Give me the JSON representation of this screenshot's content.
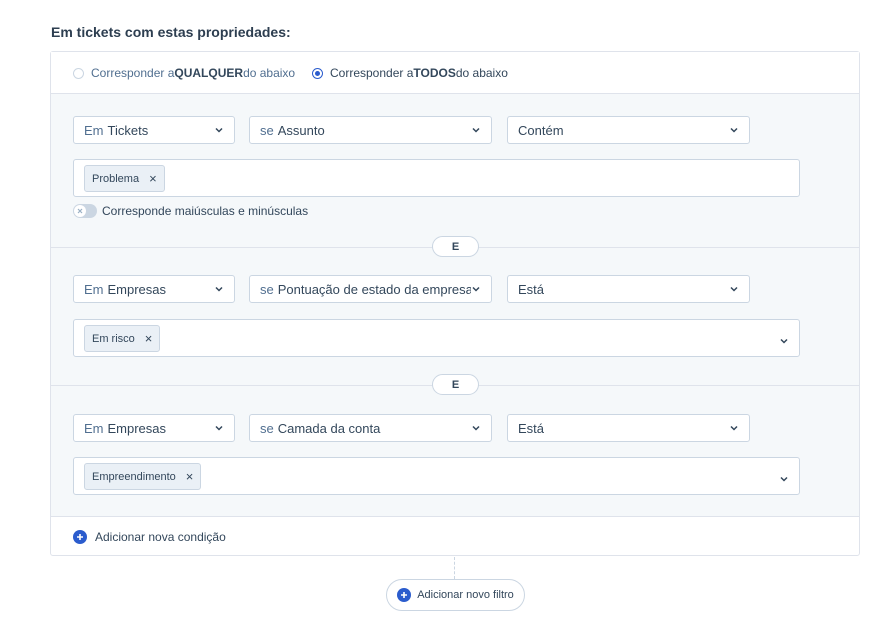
{
  "heading": "Em tickets com estas propriedades:",
  "match": {
    "any_prefix": "Corresponder a ",
    "any_strong": "QUALQUER",
    "any_suffix": " do abaixo",
    "all_prefix": "Corresponder a ",
    "all_strong": "TODOS",
    "all_suffix": " do abaixo",
    "selected": "all"
  },
  "conditions": [
    {
      "object_prefix": "Em",
      "object": "Tickets",
      "property_prefix": "se",
      "property": "Assunto",
      "operator": "Contém",
      "chip": "Problema",
      "case_toggle_label": "Corresponde maiúsculas e minúsculas",
      "case_toggle_on": false
    },
    {
      "object_prefix": "Em",
      "object": "Empresas",
      "property_prefix": "se",
      "property": "Pontuação de estado da empresa",
      "operator": "Está",
      "chip": "Em risco"
    },
    {
      "object_prefix": "Em",
      "object": "Empresas",
      "property_prefix": "se",
      "property": "Camada da conta",
      "operator": "Está",
      "chip": "Empreendimento"
    }
  ],
  "and_label": "E",
  "add_condition_label": "Adicionar nova condição",
  "add_filter_label": "Adicionar novo filtro",
  "colors": {
    "accent": "#2b5ccd",
    "border": "#cbd6e2",
    "panel_bg": "#f5f8fa"
  }
}
